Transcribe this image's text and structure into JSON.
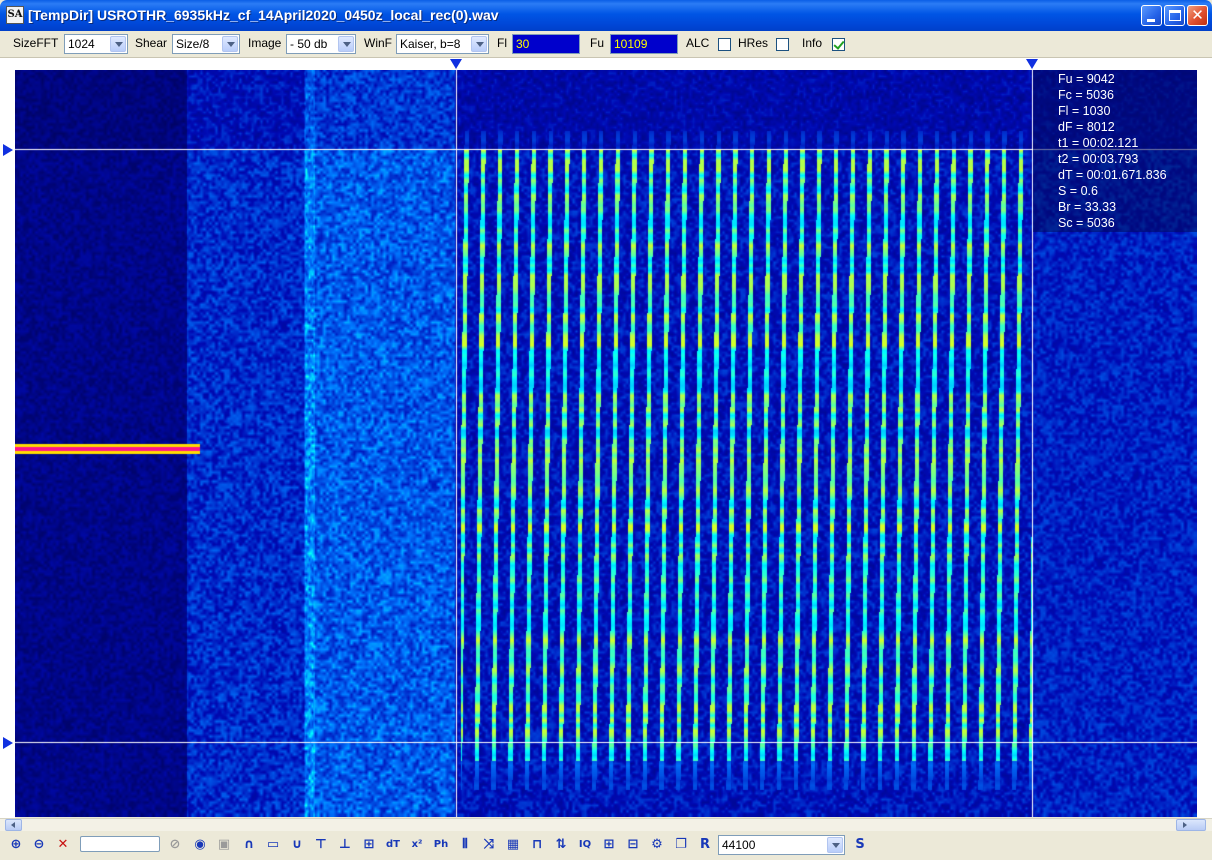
{
  "window": {
    "title": "[TempDir] USROTHR_6935kHz_cf_14April2020_0450z_local_rec(0).wav",
    "app_icon_text": "SA"
  },
  "toolbar": {
    "sizefft_label": "SizeFFT",
    "sizefft_value": "1024",
    "shear_label": "Shear",
    "shear_value": "Size/8",
    "image_label": "Image",
    "image_value": "- 50 db",
    "winf_label": "WinF",
    "winf_value": "Kaiser, b=8",
    "fl_label": "Fl",
    "fl_value": "30",
    "fu_label": "Fu",
    "fu_value": "10109",
    "alc_label": "ALC",
    "alc_checked": false,
    "hres_label": "HRes",
    "hres_checked": false,
    "info_label": "Info",
    "info_checked": true
  },
  "info_panel": [
    "Fu = 9042",
    "Fc = 5036",
    "Fl = 1030",
    "dF = 8012",
    "t1 = 00:02.121",
    "t2 = 00:03.793",
    "dT = 00:01.671.836",
    "S = 0.6",
    "Br = 33.33",
    "Sc = 5036"
  ],
  "bottombar": {
    "samplerate_value": "44100",
    "s_button_label": "S",
    "r_button_label": "R",
    "icons": [
      "zoom-in-icon",
      "zoom-out-icon",
      "reset-icon",
      "stop-icon",
      "speaker-icon",
      "square-icon",
      "bandpass-icon",
      "rectangle-icon",
      "lowpass-icon",
      "mark-start-icon",
      "mark-end-icon",
      "mark-both-icon",
      "dt-icon",
      "x-power-icon",
      "phase-icon",
      "bars-icon",
      "cross-icon",
      "grid-icon",
      "pulse-icon",
      "up-down-icon",
      "iq-icon",
      "waveform-icon",
      "waveform2-icon",
      "settings-icon",
      "copy-icon"
    ]
  },
  "colors": {
    "background_deep": "#000a50",
    "signal": "#00ffff",
    "signal_hot": "#ffff00",
    "carrier": "#ff2080",
    "cursor": "#ffffff",
    "marker": "#1030e0"
  }
}
